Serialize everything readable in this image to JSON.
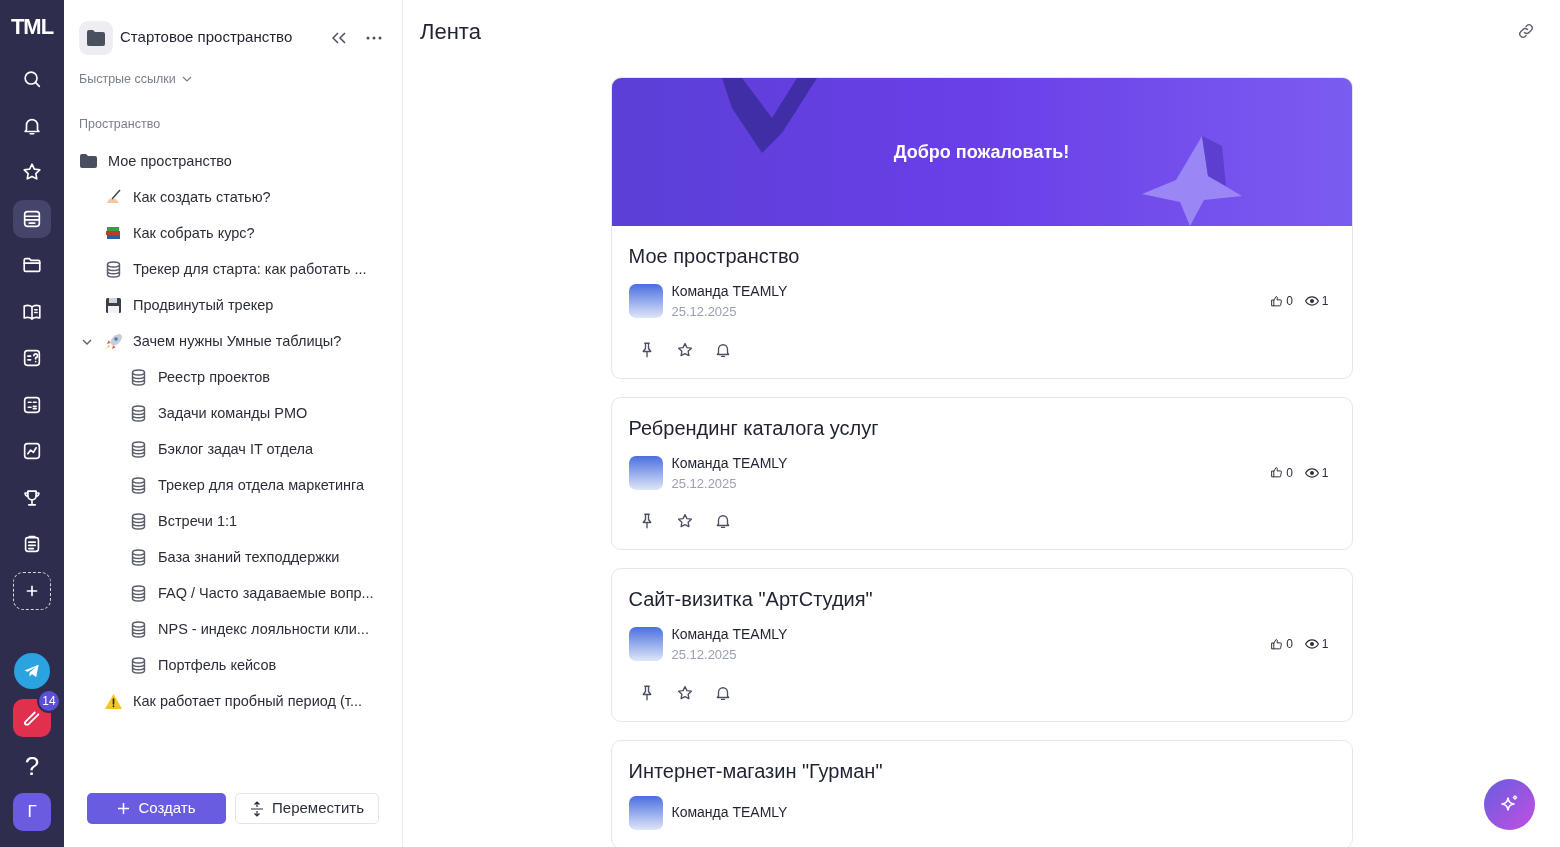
{
  "rail": {
    "logo": "TML",
    "items": [
      {
        "kind": "search",
        "selected": false
      },
      {
        "kind": "bell",
        "selected": false
      },
      {
        "kind": "star",
        "selected": false
      },
      {
        "kind": "feed",
        "selected": true
      },
      {
        "kind": "folder",
        "selected": false
      },
      {
        "kind": "book",
        "selected": false
      },
      {
        "kind": "quiz",
        "selected": false
      },
      {
        "kind": "calc",
        "selected": false
      },
      {
        "kind": "chart",
        "selected": false
      },
      {
        "kind": "trophy",
        "selected": false
      },
      {
        "kind": "clipboard",
        "selected": false
      },
      {
        "kind": "add",
        "selected": false
      }
    ],
    "apps": [
      {
        "kind": "telegram"
      },
      {
        "kind": "app",
        "badge": "14"
      }
    ],
    "help": "?",
    "avatar": "Г"
  },
  "sidebar": {
    "space_title": "Стартовое пространство",
    "quick_links": "Быстрые ссылки",
    "section": "Пространство",
    "tree": [
      {
        "label": "Мое пространство",
        "kind": "folder",
        "children": [
          {
            "label": "Как создать статью?",
            "kind": "writing"
          },
          {
            "label": "Как собрать курс?",
            "kind": "books"
          },
          {
            "label": "Трекер для старта: как работать ...",
            "kind": "database"
          },
          {
            "label": "Продвинутый трекер",
            "kind": "floppy"
          },
          {
            "label": "Зачем нужны Умные таблицы?",
            "kind": "rocket",
            "expanded": true,
            "children": [
              {
                "label": "Реестр проектов",
                "kind": "database"
              },
              {
                "label": "Задачи команды PMO",
                "kind": "database"
              },
              {
                "label": "Бэклог задач IT отдела",
                "kind": "database"
              },
              {
                "label": "Трекер для отдела маркетинга",
                "kind": "database"
              },
              {
                "label": "Встречи 1:1",
                "kind": "database"
              },
              {
                "label": "База знаний техподдержки",
                "kind": "database"
              },
              {
                "label": "FAQ / Часто задаваемые вопр...",
                "kind": "database"
              },
              {
                "label": "NPS - индекс лояльности кли...",
                "kind": "database"
              },
              {
                "label": "Портфель кейсов",
                "kind": "database"
              }
            ]
          },
          {
            "label": "Как работает пробный период (т...",
            "kind": "warning"
          }
        ]
      }
    ],
    "buttons": [
      {
        "kind": "create",
        "label": "Создать"
      },
      {
        "kind": "move",
        "label": "Переместить"
      }
    ]
  },
  "main": {
    "title": "Лента",
    "banner": "Добро пожаловать!",
    "posts": [
      {
        "title": "Мое пространство",
        "author": "Команда TEAMLY",
        "date": "25.12.2025",
        "likes": "0",
        "views": "1"
      },
      {
        "title": "Ребрендинг каталога услуг",
        "author": "Команда TEAMLY",
        "date": "25.12.2025",
        "likes": "0",
        "views": "1"
      },
      {
        "title": "Сайт-визитка \"АртСтудия\"",
        "author": "Команда TEAMLY",
        "date": "25.12.2025",
        "likes": "0",
        "views": "1"
      },
      {
        "title": "Интернет-магазин \"Гурман\"",
        "author": "Команда TEAMLY"
      }
    ]
  }
}
